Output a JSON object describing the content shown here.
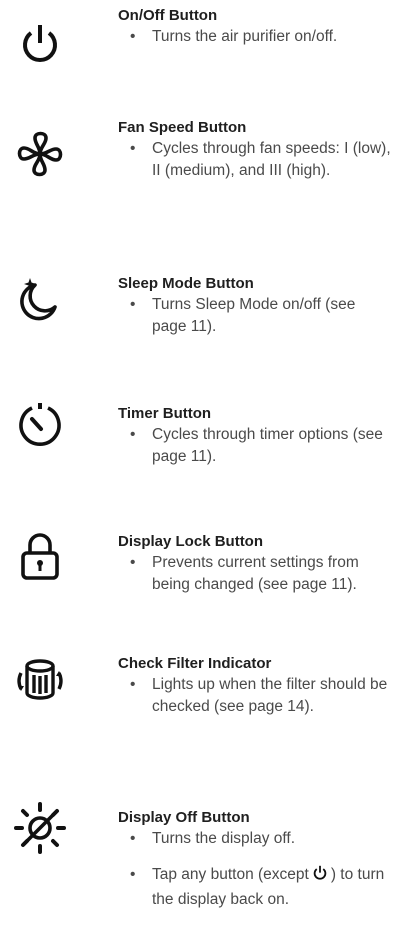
{
  "items": [
    {
      "icon": "power-icon",
      "title": "On/Off Button",
      "bullets": [
        "Turns the air purifier on/off."
      ]
    },
    {
      "icon": "fan-icon",
      "title": "Fan Speed Button",
      "bullets": [
        "Cycles through fan speeds: I (low), II (medium), and III (high)."
      ]
    },
    {
      "icon": "moon-star-icon",
      "title": "Sleep Mode Button",
      "bullets": [
        "Turns Sleep Mode on/off (see page 11)."
      ]
    },
    {
      "icon": "timer-icon",
      "title": "Timer Button",
      "bullets": [
        "Cycles through timer options (see page 11)."
      ]
    },
    {
      "icon": "padlock-icon",
      "title": "Display Lock Button",
      "bullets": [
        "Prevents current settings from being changed (see page 11)."
      ]
    },
    {
      "icon": "filter-cylinder-icon",
      "title": "Check Filter Indicator",
      "bullets": [
        "Lights up when the filter should be checked (see page 14)."
      ]
    },
    {
      "icon": "display-off-icon",
      "title": "Display Off Button",
      "bullets": [
        "Turns the display off."
      ],
      "extra_bullet": {
        "before": "Tap any button (except",
        "icon": "power-icon",
        "after": ") to turn the display back on."
      }
    }
  ]
}
